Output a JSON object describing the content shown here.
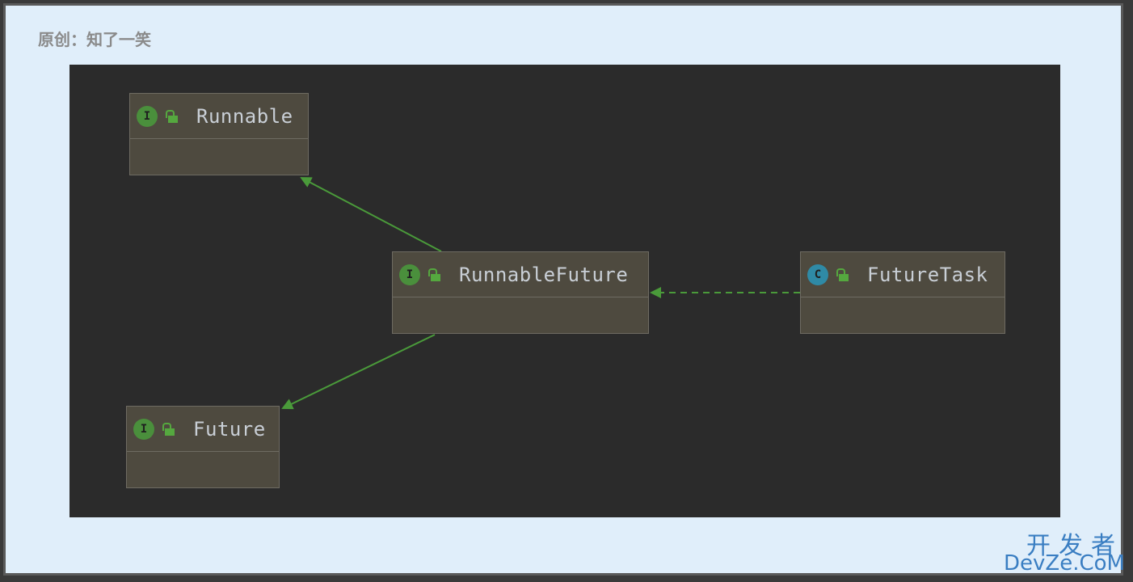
{
  "header": {
    "title": "原创：知了一笑"
  },
  "diagram": {
    "nodes": [
      {
        "id": "runnable",
        "name": "Runnable",
        "kind": "I",
        "kind_color": "#4a8f3c"
      },
      {
        "id": "runnablefuture",
        "name": "RunnableFuture",
        "kind": "I",
        "kind_color": "#4a8f3c"
      },
      {
        "id": "future",
        "name": "Future",
        "kind": "I",
        "kind_color": "#4a8f3c"
      },
      {
        "id": "futuretask",
        "name": "FutureTask",
        "kind": "C",
        "kind_color": "#2f8aa6"
      }
    ],
    "edges": [
      {
        "from": "runnablefuture",
        "to": "runnable",
        "style": "solid"
      },
      {
        "from": "runnablefuture",
        "to": "future",
        "style": "solid"
      },
      {
        "from": "futuretask",
        "to": "runnablefuture",
        "style": "dashed"
      }
    ],
    "edge_color": "#4a9a3a",
    "background": "#2b2b2b",
    "node_fill": "#4e4a3f"
  },
  "watermark": {
    "line1": "开发者",
    "line2": "DevZe.CoM"
  }
}
